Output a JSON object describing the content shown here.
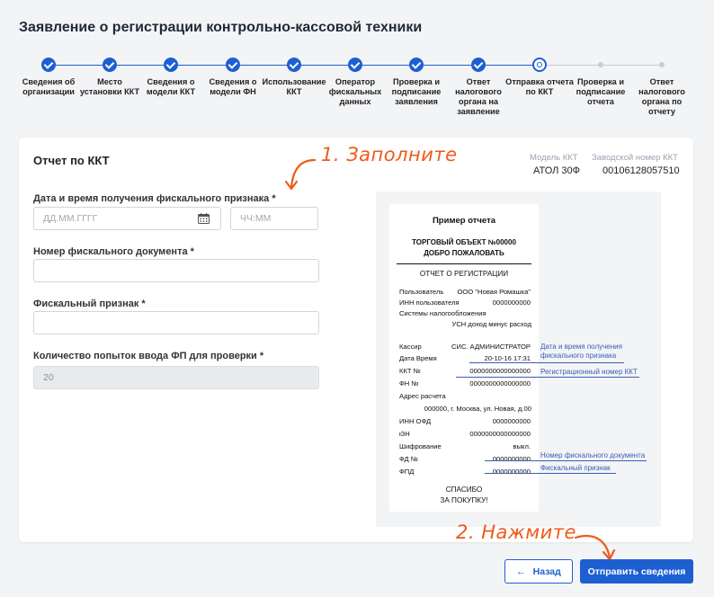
{
  "page": {
    "title": "Заявление о регистрации контрольно-кассовой техники"
  },
  "stepper": {
    "steps": [
      {
        "label": "Сведения об организации",
        "state": "done"
      },
      {
        "label": "Место установки ККТ",
        "state": "done"
      },
      {
        "label": "Сведения о модели ККТ",
        "state": "done"
      },
      {
        "label": "Сведения о модели ФН",
        "state": "done"
      },
      {
        "label": "Использование ККТ",
        "state": "done"
      },
      {
        "label": "Оператор фискальных данных",
        "state": "done"
      },
      {
        "label": "Проверка и подписание заявления",
        "state": "done"
      },
      {
        "label": "Ответ налогового органа на заявление",
        "state": "done"
      },
      {
        "label": "Отправка отчета по ККТ",
        "state": "current"
      },
      {
        "label": "Проверка и подписание отчета",
        "state": "todo"
      },
      {
        "label": "Ответ налогового органа по отчету",
        "state": "todo"
      }
    ],
    "colors": {
      "active": "#1d5fd1",
      "inactive": "#c9ccd2"
    }
  },
  "card": {
    "title": "Отчет по ККТ",
    "model_label": "Модель ККТ",
    "model_value": "АТОЛ 30Ф",
    "serial_label": "Заводской номер ККТ",
    "serial_value": "00106128057510"
  },
  "form": {
    "datetime_label": "Дата и время получения фискального признака *",
    "date_placeholder": "ДД.ММ.ГГГГ",
    "time_placeholder": "ЧЧ:ММ",
    "doc_number_label": "Номер фискального документа *",
    "doc_number_value": "",
    "fiscal_sign_label": "Фискальный признак *",
    "fiscal_sign_value": "",
    "attempts_label": "Количество попыток ввода ФП для проверки *",
    "attempts_value": "20",
    "calendar_icon": "calendar-icon"
  },
  "receipt": {
    "title": "Пример отчета",
    "shop_line1": "ТОРГОВЫЙ ОБЪЕКТ №00000",
    "shop_line2": "ДОБРО ПОЖАЛОВАТЬ",
    "report_title": "ОТЧЕТ О РЕГИСТРАЦИИ",
    "user_label": "Пользователь",
    "user_value": "ООО \"Новая Ромашка\"",
    "inn_user_label": "ИНН пользователя",
    "inn_user_value": "0000000000",
    "tax_label": "Системы налогообложения",
    "tax_value": "УСН доход минус расход",
    "cashier_label": "Кассир",
    "cashier_value": "СИС. АДМИНИСТРАТОР",
    "date_label": "Дата Время",
    "date_value": "20-10-16 17:31",
    "kkt_label": "ККТ №",
    "kkt_value": "0000000000000000",
    "fn_label": "ФН №",
    "fn_value": "0000000000000000",
    "address_label": "Адрес расчета",
    "address_value": "000000, г. Москва, ул. Новая, д.00",
    "inn_ofd_label": "ИНН ОФД",
    "inn_ofd_value": "0000000000",
    "szn_label": "ᵻЗН",
    "szn_value": "0000000000000000",
    "cipher_label": "Шифрование",
    "cipher_value": "выкл.",
    "fd_label": "ФД №",
    "fd_value": "0000000000",
    "fpd_label": "ФПД",
    "fpd_value": "0000000000",
    "thanks1": "СПАСИБО",
    "thanks2": "ЗА ПОКУПКУ!"
  },
  "notes": {
    "datetime_1": "Дата и время получения",
    "datetime_2": "фискального признака",
    "reg_number": "Регистрационный номер ККТ",
    "fd_number": "Номер фискального документа",
    "fiscal_sign": "Фискальный признак",
    "color": "#3b5db5"
  },
  "actions": {
    "back_label": "Назад",
    "back_icon": "arrow-left-icon",
    "submit_label": "Отправить сведения"
  },
  "annotations": {
    "fill_hint": "1. Заполните",
    "click_hint": "2. Нажмите",
    "color": "#f05a1a"
  }
}
